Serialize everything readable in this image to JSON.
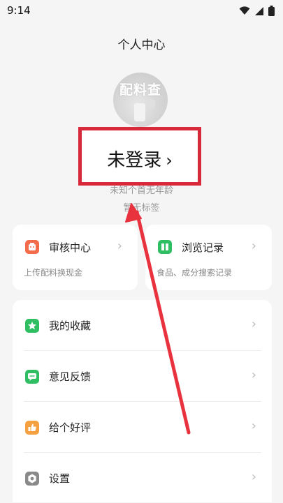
{
  "status": {
    "time": "9:14"
  },
  "header": {
    "title": "个人中心"
  },
  "profile": {
    "avatar_text": "配料查",
    "login_label": "未登录",
    "login_chevron": "›",
    "age_text": "未知个首无年龄",
    "tag_text": "暂无标签"
  },
  "cards": {
    "review": {
      "title": "审核中心",
      "subtitle": "上传配料换现金",
      "color": "#f26b4b"
    },
    "history": {
      "title": "浏览记录",
      "subtitle": "食品、成分搜索记录",
      "color": "#2fbf62"
    }
  },
  "menu": [
    {
      "label": "我的收藏",
      "icon": "star-icon",
      "color": "#2fbf62"
    },
    {
      "label": "意见反馈",
      "icon": "chat-icon",
      "color": "#2fbf62"
    },
    {
      "label": "给个好评",
      "icon": "thumbs-up-icon",
      "color": "#f5a142"
    },
    {
      "label": "设置",
      "icon": "gear-icon",
      "color": "#8a8a8a"
    }
  ],
  "chevron": "›",
  "annotation": {
    "color": "#e8333f"
  }
}
